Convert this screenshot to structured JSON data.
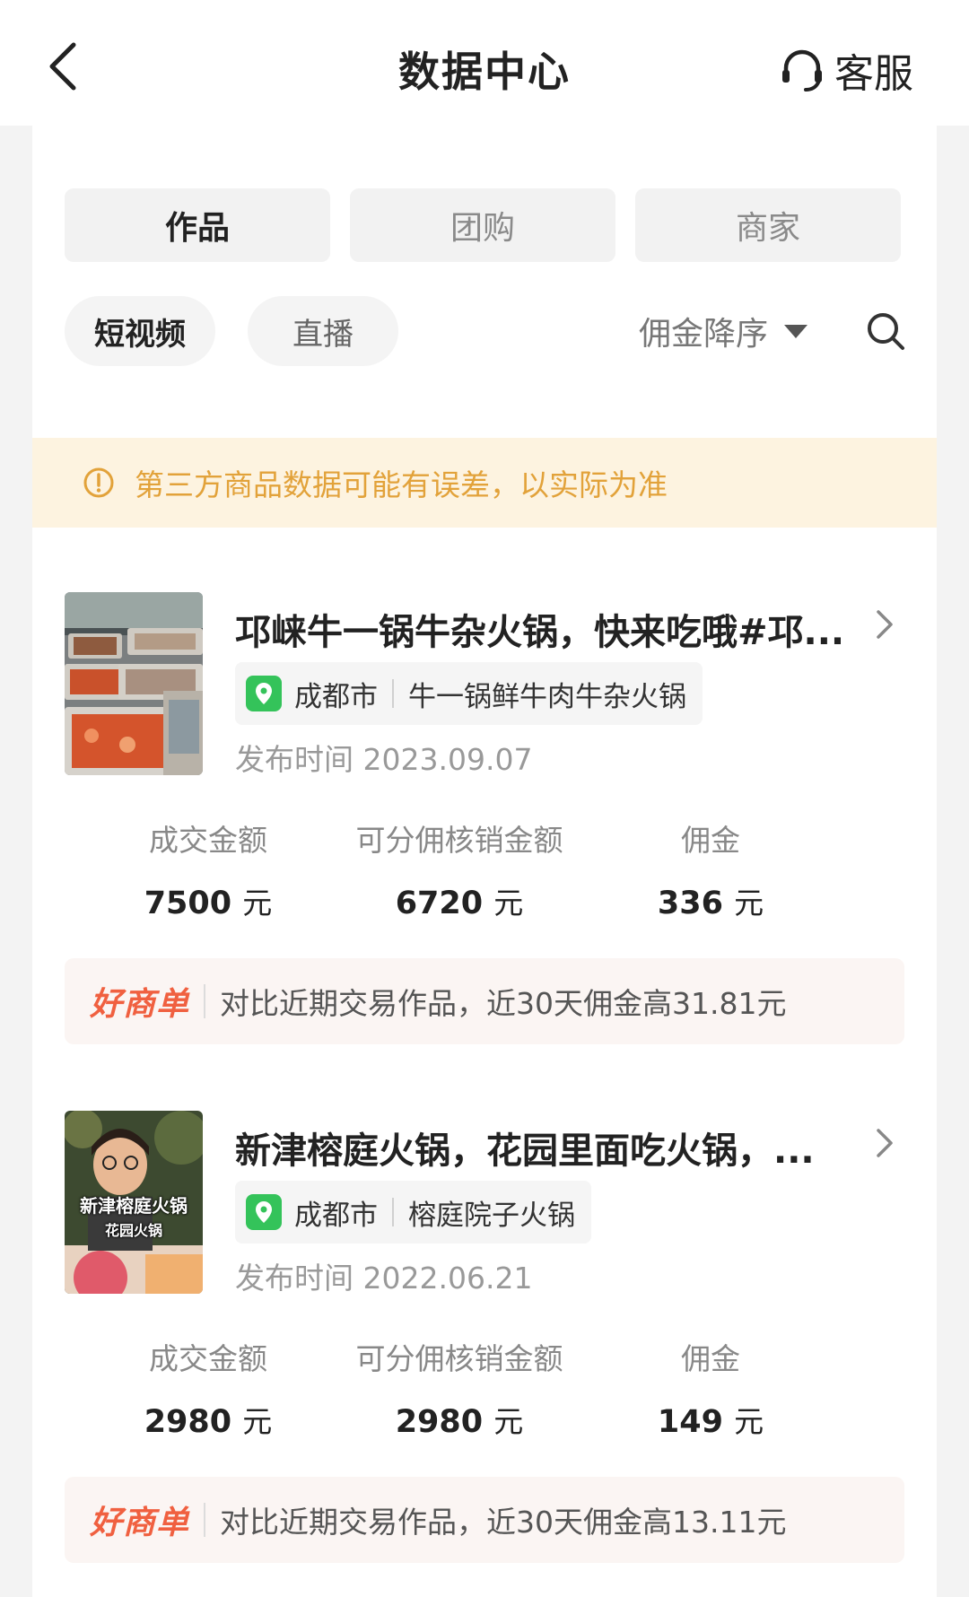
{
  "header": {
    "title": "数据中心",
    "service_label": "客服"
  },
  "tabs": [
    {
      "label": "作品",
      "active": true
    },
    {
      "label": "团购",
      "active": false
    },
    {
      "label": "商家",
      "active": false
    }
  ],
  "subtabs": [
    {
      "label": "短视频",
      "active": true
    },
    {
      "label": "直播",
      "active": false
    }
  ],
  "sort": {
    "label": "佣金降序"
  },
  "notice": {
    "text": "第三方商品数据可能有误差，以实际为准"
  },
  "items": [
    {
      "title": "邛崃牛一锅牛杂火锅，快来吃哦#邛...",
      "city": "成都市",
      "shop": "牛一锅鲜牛肉牛杂火锅",
      "published": "发布时间 2023.09.07",
      "stats": [
        {
          "label": "成交金额",
          "value": "7500",
          "unit": "元"
        },
        {
          "label": "可分佣核销金额",
          "value": "6720",
          "unit": "元"
        },
        {
          "label": "佣金",
          "value": "336",
          "unit": "元"
        }
      ],
      "promo_logo": "好商单",
      "promo_text": "对比近期交易作品，近30天佣金高31.81元"
    },
    {
      "title": "新津榕庭火锅，花园里面吃火锅，...",
      "city": "成都市",
      "shop": "榕庭院子火锅",
      "published": "发布时间 2022.06.21",
      "thumb_caption_1": "新津榕庭火锅",
      "thumb_caption_2": "花园火锅",
      "stats": [
        {
          "label": "成交金额",
          "value": "2980",
          "unit": "元"
        },
        {
          "label": "可分佣核销金额",
          "value": "2980",
          "unit": "元"
        },
        {
          "label": "佣金",
          "value": "149",
          "unit": "元"
        }
      ],
      "promo_logo": "好商单",
      "promo_text": "对比近期交易作品，近30天佣金高13.11元"
    }
  ],
  "colors": {
    "accent_orange": "#f06040",
    "notice_text": "#e2a23a",
    "notice_bg": "#fdf3e0",
    "pin_green": "#34c35a"
  }
}
